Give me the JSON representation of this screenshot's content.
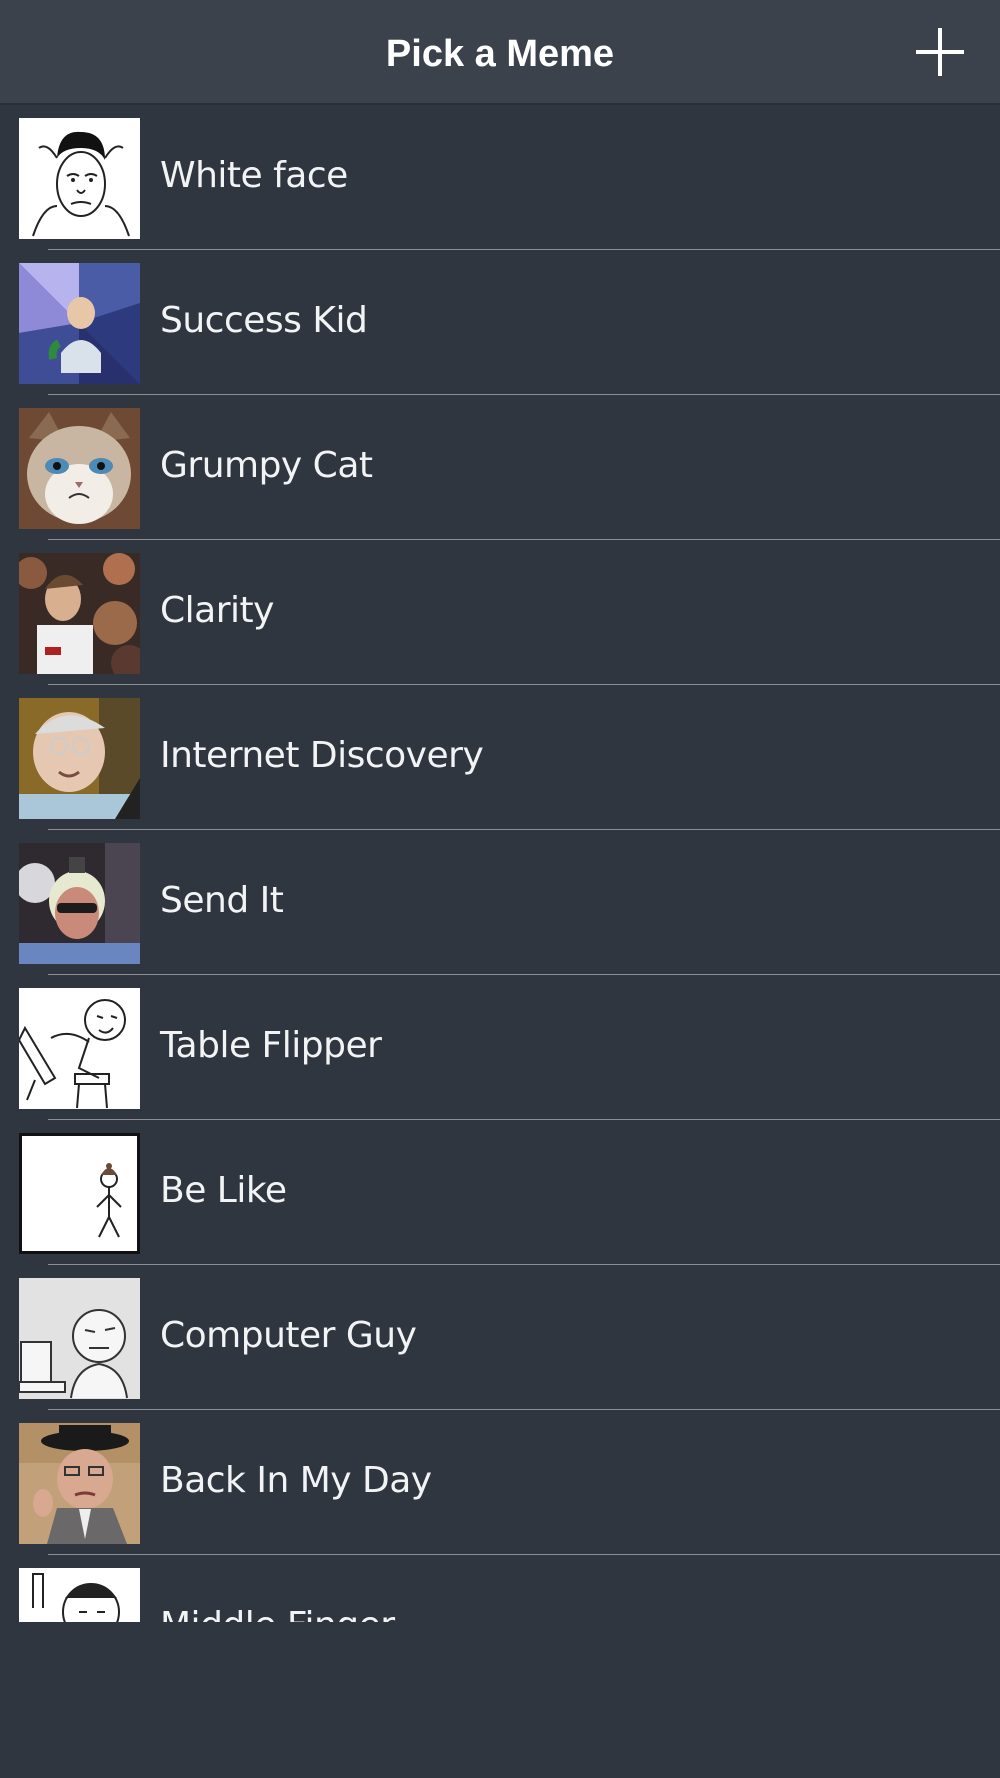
{
  "nav": {
    "title": "Pick a Meme",
    "add_icon": "plus-icon"
  },
  "colors": {
    "background": "#30363f",
    "navbar": "#3c424b",
    "separator": "#8a8f96",
    "text": "#f2f3f5"
  },
  "memes": [
    {
      "label": "White face",
      "thumbnail": "white-face-thumbnail"
    },
    {
      "label": "Success Kid",
      "thumbnail": "success-kid-thumbnail"
    },
    {
      "label": "Grumpy Cat",
      "thumbnail": "grumpy-cat-thumbnail"
    },
    {
      "label": "Clarity",
      "thumbnail": "clarity-thumbnail"
    },
    {
      "label": "Internet Discovery",
      "thumbnail": "internet-discovery-thumbnail"
    },
    {
      "label": "Send It",
      "thumbnail": "send-it-thumbnail"
    },
    {
      "label": "Table Flipper",
      "thumbnail": "table-flipper-thumbnail"
    },
    {
      "label": "Be Like",
      "thumbnail": "be-like-thumbnail"
    },
    {
      "label": "Computer Guy",
      "thumbnail": "computer-guy-thumbnail"
    },
    {
      "label": "Back In My Day",
      "thumbnail": "back-in-my-day-thumbnail"
    },
    {
      "label": "Middle Finger",
      "thumbnail": "middle-finger-thumbnail"
    }
  ]
}
